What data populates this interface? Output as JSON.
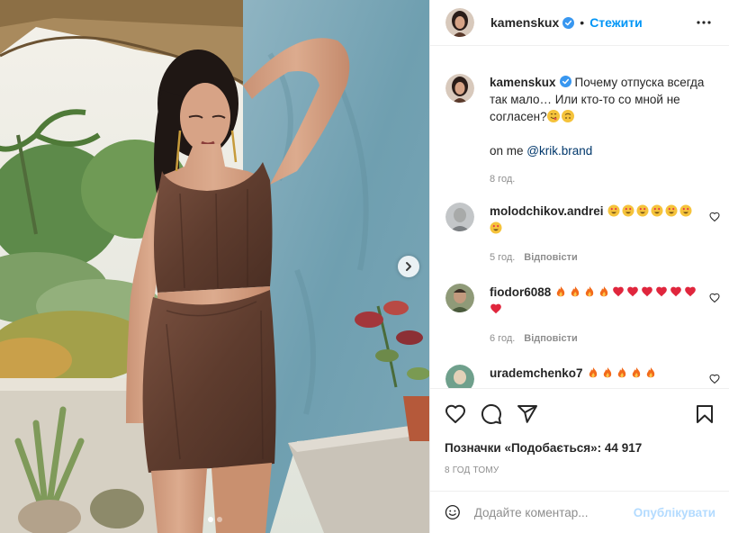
{
  "post": {
    "username": "kamenskux",
    "follow_label": "Стежити",
    "separator": "•"
  },
  "caption": {
    "username": "kamenskux",
    "text": "Почему отпуска всегда так мало… Или кто-то со мной не согласен?",
    "emojis": [
      "yum-face-icon",
      "upside-down-face-icon"
    ],
    "on_me_label": "on me",
    "mention": "@krik.brand",
    "time": "8 год."
  },
  "comments": [
    {
      "username": "molodchikov.andrei",
      "emoji": "heart-eyes",
      "emoji_count": 7,
      "time": "5 год.",
      "reply_label": "Відповісти"
    },
    {
      "username": "fiodor6088",
      "emoji_sequence": [
        "fire",
        "fire",
        "fire",
        "fire",
        "heart",
        "heart",
        "heart",
        "heart",
        "heart",
        "heart",
        "heart"
      ],
      "time": "6 год.",
      "reply_label": "Відповісти"
    },
    {
      "username": "urademchenko7",
      "emoji": "fire",
      "emoji_count": 5
    }
  ],
  "likes": {
    "label": "Позначки «Подобається»:",
    "count": "44 917"
  },
  "posted_ago": "8 ГОД ТОМУ",
  "add_comment": {
    "placeholder": "Додайте коментар...",
    "post_label": "Опублікувати"
  },
  "carousel": {
    "slides": 2,
    "active_index": 0
  },
  "colors": {
    "accent": "#0095f6",
    "text": "#262626",
    "muted": "#8e8e8e",
    "heart": "#ed4956",
    "verified": "#3897f0"
  }
}
